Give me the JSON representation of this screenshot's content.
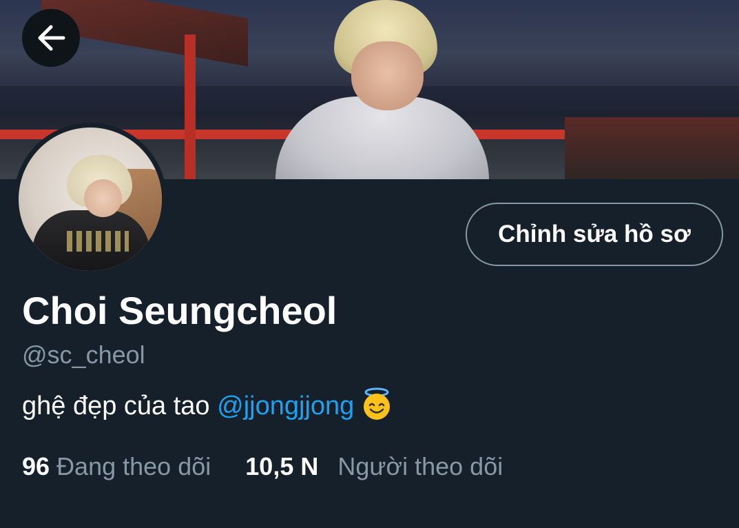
{
  "header": {
    "back_icon": "arrow-left-icon"
  },
  "profile": {
    "edit_button_label": "Chỉnh sửa hồ sơ",
    "display_name": "Choi Seungcheol",
    "handle": "@sc_cheol",
    "bio_text": "ghệ đẹp của tao ",
    "bio_mention": "@jjongjjong",
    "bio_emoji": "smiling-face-with-halo-emoji",
    "following_count": "96",
    "following_label": "Đang theo dõi",
    "followers_count": "10,5 N",
    "followers_label": "Người theo dõi"
  },
  "colors": {
    "background": "#15202b",
    "accent": "#1da1f2",
    "secondary_text": "#8899a6",
    "primary_text": "#ffffff"
  }
}
